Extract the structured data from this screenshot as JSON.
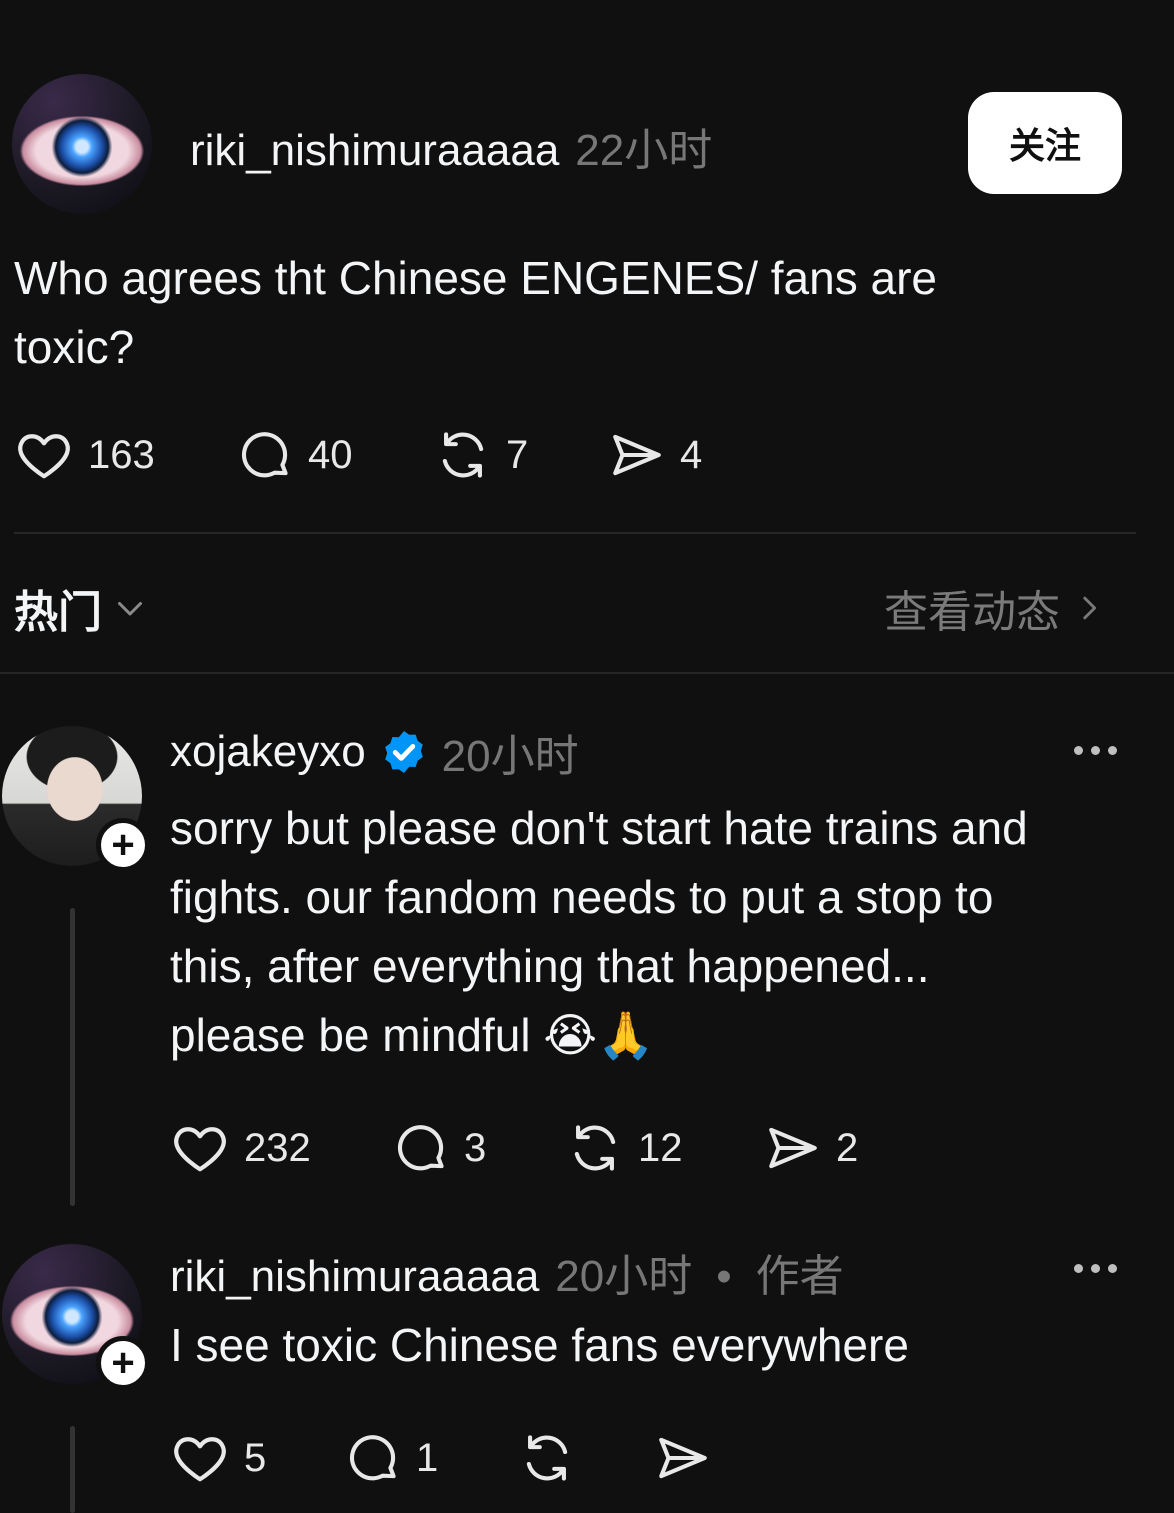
{
  "post": {
    "username": "riki_nishimuraaaaa",
    "time": "22小时",
    "follow_label": "关注",
    "text_line1": "Who agrees tht Chinese ENGENES/ fans are",
    "text_line2": "toxic?",
    "likes": "163",
    "comments": "40",
    "reposts": "7",
    "shares": "4"
  },
  "filter": {
    "sort_label": "热门",
    "view_activity": "查看动态"
  },
  "replies": [
    {
      "username": "xojakeyxo",
      "verified": true,
      "time": "20小时",
      "lines": [
        "sorry but please don't start hate trains and",
        "fights. our fandom needs to put a stop to",
        "this, after everything that happened...",
        "please be mindful 😭🙏"
      ],
      "likes": "232",
      "comments": "3",
      "reposts": "12",
      "shares": "2"
    },
    {
      "username": "riki_nishimuraaaaa",
      "time": "20小时",
      "separator": "•",
      "author_tag": "作者",
      "lines": [
        "I see toxic Chinese fans everywhere"
      ],
      "likes": "5",
      "comments": "1"
    }
  ],
  "icons": {
    "like": "heart-icon",
    "comment": "comment-bubble-icon",
    "repost": "repost-icon",
    "share": "send-icon",
    "more": "more-dots-icon",
    "follow_plus": "plus-icon",
    "verified": "verified-badge-icon"
  },
  "colors": {
    "background": "#101010",
    "text": "#f3f5f7",
    "muted": "#777777",
    "verified": "#0095f6"
  }
}
